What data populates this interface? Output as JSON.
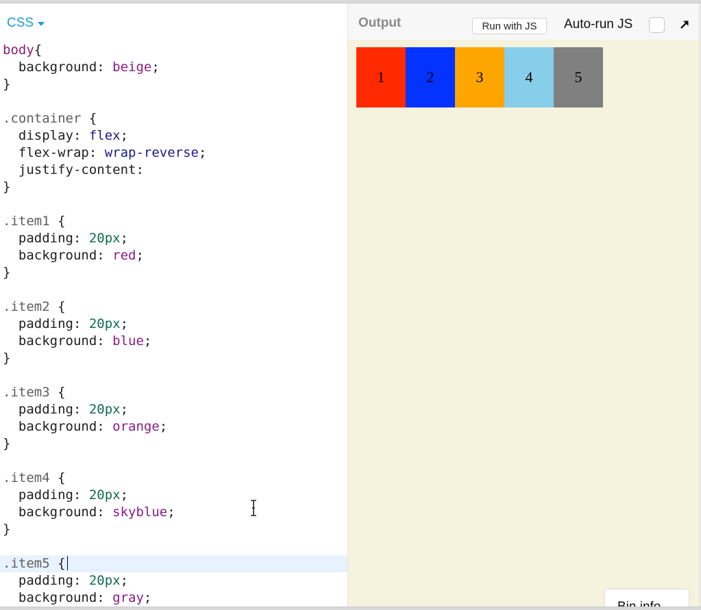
{
  "editor": {
    "panel_title": "CSS",
    "lines": [
      [
        {
          "t": "body",
          "c": "sel-tag"
        },
        {
          "t": "{",
          "c": "punc"
        }
      ],
      [
        {
          "t": "  background: ",
          "c": "prop"
        },
        {
          "t": "beige",
          "c": "str"
        },
        {
          "t": ";",
          "c": "punc"
        }
      ],
      [
        {
          "t": "}",
          "c": "punc"
        }
      ],
      [],
      [
        {
          "t": ".container",
          "c": "sel"
        },
        {
          "t": " {",
          "c": "punc"
        }
      ],
      [
        {
          "t": "  display: ",
          "c": "prop"
        },
        {
          "t": "flex",
          "c": "kw"
        },
        {
          "t": ";",
          "c": "punc"
        }
      ],
      [
        {
          "t": "  flex-wrap: ",
          "c": "prop"
        },
        {
          "t": "wrap-reverse",
          "c": "kw"
        },
        {
          "t": ";",
          "c": "punc"
        }
      ],
      [
        {
          "t": "  justify-content:",
          "c": "prop"
        }
      ],
      [
        {
          "t": "}",
          "c": "punc"
        }
      ],
      [],
      [
        {
          "t": ".item1",
          "c": "sel"
        },
        {
          "t": " {",
          "c": "punc"
        }
      ],
      [
        {
          "t": "  padding: ",
          "c": "prop"
        },
        {
          "t": "20px",
          "c": "num"
        },
        {
          "t": ";",
          "c": "punc"
        }
      ],
      [
        {
          "t": "  background: ",
          "c": "prop"
        },
        {
          "t": "red",
          "c": "str"
        },
        {
          "t": ";",
          "c": "punc"
        }
      ],
      [
        {
          "t": "}",
          "c": "punc"
        }
      ],
      [],
      [
        {
          "t": ".item2",
          "c": "sel"
        },
        {
          "t": " {",
          "c": "punc"
        }
      ],
      [
        {
          "t": "  padding: ",
          "c": "prop"
        },
        {
          "t": "20px",
          "c": "num"
        },
        {
          "t": ";",
          "c": "punc"
        }
      ],
      [
        {
          "t": "  background: ",
          "c": "prop"
        },
        {
          "t": "blue",
          "c": "str"
        },
        {
          "t": ";",
          "c": "punc"
        }
      ],
      [
        {
          "t": "}",
          "c": "punc"
        }
      ],
      [],
      [
        {
          "t": ".item3",
          "c": "sel"
        },
        {
          "t": " {",
          "c": "punc"
        }
      ],
      [
        {
          "t": "  padding: ",
          "c": "prop"
        },
        {
          "t": "20px",
          "c": "num"
        },
        {
          "t": ";",
          "c": "punc"
        }
      ],
      [
        {
          "t": "  background: ",
          "c": "prop"
        },
        {
          "t": "orange",
          "c": "str"
        },
        {
          "t": ";",
          "c": "punc"
        }
      ],
      [
        {
          "t": "}",
          "c": "punc"
        }
      ],
      [],
      [
        {
          "t": ".item4",
          "c": "sel"
        },
        {
          "t": " {",
          "c": "punc"
        }
      ],
      [
        {
          "t": "  padding: ",
          "c": "prop"
        },
        {
          "t": "20px",
          "c": "num"
        },
        {
          "t": ";",
          "c": "punc"
        }
      ],
      [
        {
          "t": "  background: ",
          "c": "prop"
        },
        {
          "t": "skyblue",
          "c": "str"
        },
        {
          "t": ";",
          "c": "punc"
        }
      ],
      [
        {
          "t": "}",
          "c": "punc"
        }
      ],
      [],
      [
        {
          "t": ".item5",
          "c": "sel"
        },
        {
          "t": " {",
          "c": "punc"
        }
      ],
      [
        {
          "t": "  padding: ",
          "c": "prop"
        },
        {
          "t": "20px",
          "c": "num"
        },
        {
          "t": ";",
          "c": "punc"
        }
      ],
      [
        {
          "t": "  background: ",
          "c": "prop"
        },
        {
          "t": "gray",
          "c": "str"
        },
        {
          "t": ";",
          "c": "punc"
        }
      ]
    ],
    "active_line": 30
  },
  "output": {
    "title": "Output",
    "run_button": "Run with JS",
    "autorun_label": "Auto-run JS",
    "autorun_checked": false,
    "items": [
      {
        "label": "1",
        "color": "#ff2a00"
      },
      {
        "label": "2",
        "color": "#0432ff"
      },
      {
        "label": "3",
        "color": "#ffa500"
      },
      {
        "label": "4",
        "color": "#87ceeb"
      },
      {
        "label": "5",
        "color": "#808080"
      }
    ],
    "bin_info": "Bin info"
  },
  "colors": {
    "accent": "#1a9ed8",
    "output_bg": "#f5f2dd"
  }
}
